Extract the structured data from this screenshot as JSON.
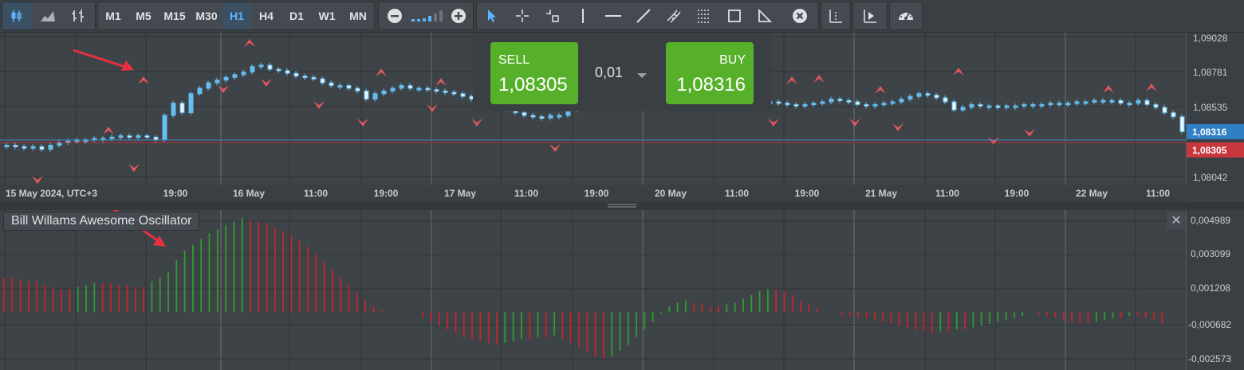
{
  "toolbar": {
    "chart_type_icons": [
      "candlestick-icon",
      "area-chart-icon",
      "bar-chart-icon"
    ],
    "timeframes": [
      "M1",
      "M5",
      "M15",
      "M30",
      "H1",
      "H4",
      "D1",
      "W1",
      "MN"
    ],
    "active_timeframe": "H1",
    "zoom_icons": [
      "zoom-out-icon",
      "zoom-level-icon",
      "zoom-in-icon"
    ],
    "drawing_tools": [
      "cursor-icon",
      "crosshair-icon",
      "time-cursor-icon",
      "vertical-line-icon",
      "horizontal-line-icon",
      "trend-line-icon",
      "andrews-pitchfork-icon",
      "fibonacci-icon",
      "rectangle-icon",
      "triangle-icon",
      "delete-all-icon"
    ],
    "extra_tools": [
      "period-separator-icon",
      "chart-shift-icon",
      "dashboard-icon"
    ]
  },
  "trade": {
    "sell_label": "SELL",
    "sell_price": "1,08305",
    "volume": "0,01",
    "buy_label": "BUY",
    "buy_price": "1,08316"
  },
  "price_axis": {
    "ticks": [
      "1,09028",
      "1,08781",
      "1,08535",
      "1,08042"
    ],
    "ask_badge": "1,08316",
    "bid_badge": "1,08305",
    "ask_color": "#2f7fc4",
    "bid_color": "#c8373b"
  },
  "time_axis": {
    "labels": [
      "15 May 2024, UTC+3",
      "19:00",
      "16 May",
      "11:00",
      "19:00",
      "17 May",
      "11:00",
      "19:00",
      "20 May",
      "11:00",
      "19:00",
      "21 May",
      "11:00",
      "19:00",
      "22 May",
      "11:00"
    ]
  },
  "indicator": {
    "name": "Bill Willams Awesome Oscillator",
    "close_label": "✕",
    "axis_ticks": [
      "0,004989",
      "0,003099",
      "0,001208",
      "-0,000682",
      "-0,002573"
    ]
  },
  "colors": {
    "candle": "#64bff0",
    "fractal": "#e2585b",
    "ao_up": "#2e9d2e",
    "ao_down": "#c2262b",
    "arrow": "#e8313f",
    "buy_sell": "#56b02a"
  },
  "chart_data": {
    "type": "candlestick",
    "symbol_chart": {
      "y_range": [
        1.0795,
        1.0907
      ],
      "candles_close": [
        1.0824,
        1.0823,
        1.0822,
        1.0823,
        1.0821,
        1.0824,
        1.0826,
        1.0827,
        1.0828,
        1.0828,
        1.0829,
        1.0829,
        1.083,
        1.0831,
        1.083,
        1.0831,
        1.083,
        1.0828,
        1.0846,
        1.0855,
        1.0848,
        1.0862,
        1.0866,
        1.087,
        1.0872,
        1.0874,
        1.0876,
        1.0878,
        1.0882,
        1.0883,
        1.088,
        1.0879,
        1.0877,
        1.0875,
        1.0874,
        1.0873,
        1.087,
        1.0868,
        1.0868,
        1.0866,
        1.0864,
        1.0858,
        1.0862,
        1.0864,
        1.0866,
        1.0868,
        1.0866,
        1.0866,
        1.0865,
        1.0864,
        1.0863,
        1.0862,
        1.086,
        1.0858,
        1.0856,
        1.0855,
        1.0852,
        1.085,
        1.0848,
        1.0846,
        1.0845,
        1.0844,
        1.0846,
        1.0846,
        1.085,
        1.0853,
        1.0858,
        1.086,
        1.0862,
        1.086,
        1.0861,
        1.086,
        1.086,
        1.0858,
        1.0857,
        1.0856,
        1.0855,
        1.0854,
        1.0853,
        1.0852,
        1.0853,
        1.0853,
        1.0852,
        1.0851,
        1.0855,
        1.0857,
        1.0856,
        1.0856,
        1.0855,
        1.0854,
        1.0853,
        1.0854,
        1.0855,
        1.0856,
        1.0858,
        1.0857,
        1.0856,
        1.0854,
        1.0853,
        1.0854,
        1.0855,
        1.0856,
        1.0858,
        1.086,
        1.0862,
        1.0861,
        1.0859,
        1.0856,
        1.085,
        1.0852,
        1.0854,
        1.0853,
        1.0853,
        1.0852,
        1.0853,
        1.0853,
        1.0854,
        1.0854,
        1.0854,
        1.0855,
        1.0855,
        1.0855,
        1.0856,
        1.0856,
        1.0857,
        1.0857,
        1.0857,
        1.0855,
        1.0855,
        1.0857,
        1.0854,
        1.0852,
        1.0848,
        1.0845,
        1.0834
      ]
    },
    "oscillator": {
      "y_range": [
        -0.003,
        0.0053
      ],
      "bar_colors": "green when value rises vs previous bar, red when it falls",
      "values": [
        0.0018,
        0.0018,
        0.0017,
        0.0016,
        0.0016,
        0.0014,
        0.0013,
        0.0012,
        0.0012,
        0.0013,
        0.0014,
        0.0015,
        0.0015,
        0.0015,
        0.0014,
        0.0014,
        0.0013,
        0.0013,
        0.0016,
        0.0018,
        0.0021,
        0.0027,
        0.0032,
        0.0035,
        0.0038,
        0.0041,
        0.0043,
        0.0045,
        0.0047,
        0.0049,
        0.0048,
        0.0047,
        0.0046,
        0.0044,
        0.0042,
        0.004,
        0.0037,
        0.0034,
        0.003,
        0.0026,
        0.0022,
        0.0018,
        0.0014,
        0.001,
        0.0006,
        0.0003,
        0.0001,
        0.0,
        0.0,
        0.0,
        0.0,
        -0.0003,
        -0.0005,
        -0.0007,
        -0.0009,
        -0.0011,
        -0.0013,
        -0.0014,
        -0.0015,
        -0.0016,
        -0.0017,
        -0.0016,
        -0.0015,
        -0.0014,
        -0.0014,
        -0.0013,
        -0.0013,
        -0.0012,
        -0.0014,
        -0.0016,
        -0.0018,
        -0.0021,
        -0.0023,
        -0.0024,
        -0.0023,
        -0.002,
        -0.0017,
        -0.0013,
        -0.0009,
        -0.0005,
        -0.0001,
        0.0003,
        0.0005,
        0.0006,
        0.0005,
        0.0004,
        0.0003,
        0.0003,
        0.0004,
        0.0005,
        0.0007,
        0.0009,
        0.0011,
        0.0012,
        0.0012,
        0.0011,
        0.0009,
        0.0006,
        0.0004,
        0.0002,
        0.0,
        0.0,
        -0.0002,
        -0.0002,
        -0.0003,
        -0.0003,
        -0.0004,
        -0.0005,
        -0.0006,
        -0.0007,
        -0.0008,
        -0.0009,
        -0.001,
        -0.0011,
        -0.001,
        -0.001,
        -0.0009,
        -0.0009,
        -0.0008,
        -0.0007,
        -0.0006,
        -0.0005,
        -0.0004,
        -0.0003,
        -0.0002,
        0.0,
        -0.0001,
        -0.0002,
        -0.0003,
        -0.0004,
        -0.0005,
        -0.0006,
        -0.0006,
        -0.0005,
        -0.0004,
        -0.0003,
        -0.0003,
        -0.0002,
        -0.0002,
        -0.0003,
        -0.0004,
        -0.0006
      ]
    }
  }
}
